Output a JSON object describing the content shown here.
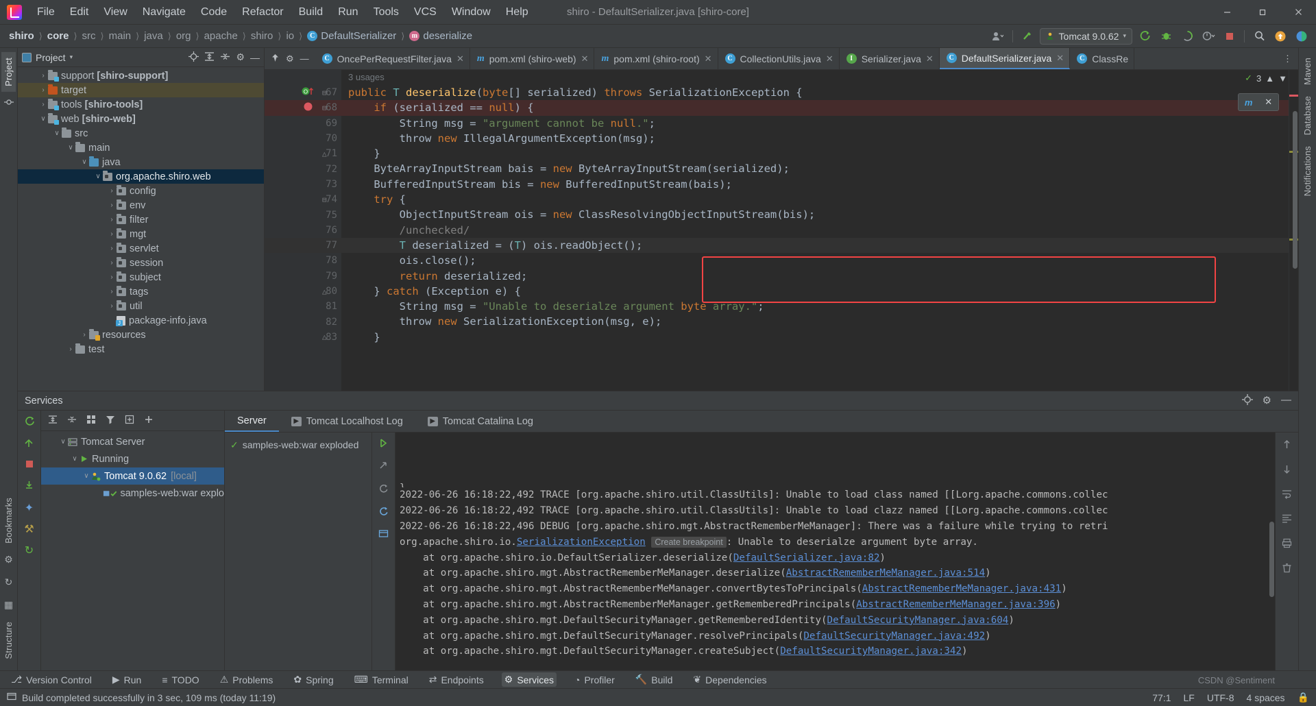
{
  "window": {
    "title": "shiro - DefaultSerializer.java [shiro-core]",
    "minimize": "—",
    "maximize": "❐",
    "close": "✕"
  },
  "menubar": {
    "items": [
      "File",
      "Edit",
      "View",
      "Navigate",
      "Code",
      "Refactor",
      "Build",
      "Run",
      "Tools",
      "VCS",
      "Window",
      "Help"
    ]
  },
  "breadcrumb": {
    "items": [
      {
        "label": "shiro",
        "style": "bold"
      },
      {
        "label": "core",
        "style": "bold"
      },
      {
        "label": "src",
        "style": "dim"
      },
      {
        "label": "main",
        "style": "dim"
      },
      {
        "label": "java",
        "style": "dim"
      },
      {
        "label": "org",
        "style": "dim"
      },
      {
        "label": "apache",
        "style": "dim"
      },
      {
        "label": "shiro",
        "style": "dim"
      },
      {
        "label": "io",
        "style": "dim"
      },
      {
        "label": "DefaultSerializer",
        "style": "class",
        "icon": "C"
      },
      {
        "label": "deserialize",
        "style": "method",
        "icon": "m"
      }
    ],
    "separator": "〉"
  },
  "toolbar": {
    "run_configuration": "Tomcat 9.0.62",
    "icons": {
      "profile": "profile-icon",
      "chevron": "▾",
      "build_hammer": "ⴰ",
      "run": "⟳",
      "debug": "debug-icon",
      "coverage": "coverage-icon",
      "profiler": "profiler-icon",
      "stop": "stop-icon",
      "search": "⌕",
      "updates": "↑",
      "ide_help": "ide-icon"
    }
  },
  "project_panel": {
    "title": "Project",
    "actions": [
      "locate-icon",
      "expand-all-icon",
      "collapse-all-icon",
      "settings-icon",
      "hide-icon"
    ],
    "tree": [
      {
        "label": "support [shiro-support]",
        "bold_part": "[shiro-support]",
        "indent": 1,
        "arrow": "›",
        "icon": "module",
        "state": "normal"
      },
      {
        "label": "target",
        "indent": 1,
        "arrow": "›",
        "icon": "excluded",
        "state": "highlight"
      },
      {
        "label": "tools [shiro-tools]",
        "bold_part": "[shiro-tools]",
        "indent": 1,
        "arrow": "›",
        "icon": "module",
        "state": "normal"
      },
      {
        "label": "web [shiro-web]",
        "bold_part": "[shiro-web]",
        "indent": 1,
        "arrow": "∨",
        "icon": "module",
        "state": "normal"
      },
      {
        "label": "src",
        "indent": 2,
        "arrow": "∨",
        "icon": "folder",
        "state": "normal"
      },
      {
        "label": "main",
        "indent": 3,
        "arrow": "∨",
        "icon": "folder",
        "state": "normal"
      },
      {
        "label": "java",
        "indent": 4,
        "arrow": "∨",
        "icon": "source",
        "state": "normal"
      },
      {
        "label": "org.apache.shiro.web",
        "indent": 5,
        "arrow": "∨",
        "icon": "package",
        "state": "selected"
      },
      {
        "label": "config",
        "indent": 6,
        "arrow": "›",
        "icon": "package",
        "state": "normal"
      },
      {
        "label": "env",
        "indent": 6,
        "arrow": "›",
        "icon": "package",
        "state": "normal"
      },
      {
        "label": "filter",
        "indent": 6,
        "arrow": "›",
        "icon": "package",
        "state": "normal"
      },
      {
        "label": "mgt",
        "indent": 6,
        "arrow": "›",
        "icon": "package",
        "state": "normal"
      },
      {
        "label": "servlet",
        "indent": 6,
        "arrow": "›",
        "icon": "package",
        "state": "normal"
      },
      {
        "label": "session",
        "indent": 6,
        "arrow": "›",
        "icon": "package",
        "state": "normal"
      },
      {
        "label": "subject",
        "indent": 6,
        "arrow": "›",
        "icon": "package",
        "state": "normal"
      },
      {
        "label": "tags",
        "indent": 6,
        "arrow": "›",
        "icon": "package",
        "state": "normal"
      },
      {
        "label": "util",
        "indent": 6,
        "arrow": "›",
        "icon": "package",
        "state": "normal"
      },
      {
        "label": "package-info.java",
        "indent": 6,
        "arrow": "",
        "icon": "javafile",
        "state": "normal"
      },
      {
        "label": "resources",
        "indent": 4,
        "arrow": "›",
        "icon": "resources",
        "state": "normal"
      },
      {
        "label": "test",
        "indent": 3,
        "arrow": "›",
        "icon": "folder",
        "state": "normal"
      }
    ]
  },
  "editor_tabs": {
    "lead_icons": [
      "pin-icon",
      "settings-icon",
      "minimize-icon"
    ],
    "tabs": [
      {
        "label": "OncePerRequestFilter.java",
        "icon": "C",
        "active": false,
        "close": "✕"
      },
      {
        "label": "pom.xml (shiro-web)",
        "icon": "m",
        "active": false,
        "close": "✕"
      },
      {
        "label": "pom.xml (shiro-root)",
        "icon": "m",
        "active": false,
        "close": "✕"
      },
      {
        "label": "CollectionUtils.java",
        "icon": "C",
        "active": false,
        "close": "✕"
      },
      {
        "label": "Serializer.java",
        "icon": "I",
        "active": false,
        "close": "✕"
      },
      {
        "label": "DefaultSerializer.java",
        "icon": "C",
        "active": true,
        "close": "✕"
      },
      {
        "label": "ClassRe",
        "icon": "C",
        "active": false,
        "close": ""
      }
    ],
    "overflow": "⋮"
  },
  "editor": {
    "usages_hint": "3 usages",
    "inspection_count": "3",
    "lines": [
      {
        "num": "67",
        "indent": 0,
        "mark": "method-gutter-icon"
      },
      {
        "num": "68",
        "indent": 0,
        "mark": "breakpoint"
      },
      {
        "num": "69",
        "indent": 0
      },
      {
        "num": "70",
        "indent": 0
      },
      {
        "num": "71",
        "indent": 0
      },
      {
        "num": "72",
        "indent": 0
      },
      {
        "num": "73",
        "indent": 0
      },
      {
        "num": "74",
        "indent": 0
      },
      {
        "num": "75",
        "indent": 0
      },
      {
        "num": "76",
        "indent": 0
      },
      {
        "num": "77",
        "indent": 0
      },
      {
        "num": "78",
        "indent": 0
      },
      {
        "num": "79",
        "indent": 0
      },
      {
        "num": "80",
        "indent": 0
      },
      {
        "num": "81",
        "indent": 0
      },
      {
        "num": "82",
        "indent": 0
      },
      {
        "num": "83",
        "indent": 0
      }
    ],
    "source_text": [
      "public T deserialize(byte[] serialized) throws SerializationException {",
      "    if (serialized == null) {",
      "        String msg = \"argument cannot be null.\";",
      "        throw new IllegalArgumentException(msg);",
      "    }",
      "    ByteArrayInputStream bais = new ByteArrayInputStream(serialized);",
      "    BufferedInputStream bis = new BufferedInputStream(bais);",
      "    try {",
      "        ObjectInputStream ois = new ClassResolvingObjectInputStream(bis);",
      "        /unchecked/",
      "        T deserialized = (T) ois.readObject();",
      "        ois.close();",
      "        return deserialized;",
      "    } catch (Exception e) {",
      "        String msg = \"Unable to deserialze argument byte array.\";",
      "        throw new SerializationException(msg, e);",
      "    }"
    ]
  },
  "services": {
    "title": "Services",
    "header_actions": [
      "locate-icon",
      "settings-icon",
      "hide-icon"
    ],
    "toolbar_icons": [
      "rerun-icon",
      "expand-icon",
      "collapse-icon",
      "stop-icon",
      "deploy-icon",
      "wrench-icon",
      "refresh-icon"
    ],
    "tree_toolbar_icons": [
      "expand-all-icon",
      "collapse-all-icon",
      "group-icon",
      "filter-icon",
      "show-icon",
      "add-icon"
    ],
    "tree": [
      {
        "label": "Tomcat Server",
        "indent": 1,
        "arrow": "∨",
        "icon": "server-icon",
        "state": "normal"
      },
      {
        "label": "Running",
        "indent": 2,
        "arrow": "∨",
        "icon": "run-green-icon",
        "state": "normal"
      },
      {
        "label": "Tomcat 9.0.62",
        "suffix": "[local]",
        "indent": 3,
        "arrow": "∨",
        "icon": "tomcat-icon",
        "state": "selected"
      },
      {
        "label": "samples-web:war explo",
        "indent": 4,
        "arrow": "",
        "icon": "artifact-ok-icon",
        "state": "normal"
      }
    ],
    "tabs": [
      {
        "label": "Server",
        "active": true
      },
      {
        "label": "Tomcat Localhost Log",
        "active": false,
        "icon": "run-icon"
      },
      {
        "label": "Tomcat Catalina Log",
        "active": false,
        "icon": "run-icon"
      }
    ],
    "run_items": [
      {
        "label": "samples-web:war exploded",
        "icon": "check-icon"
      }
    ],
    "console_toolbar_icons": [
      "rerun-icon",
      "redeploy-icon",
      "restart-icon",
      "update-icon",
      "browser-icon"
    ],
    "right_toolbar_icons": [
      "scroll-up-icon",
      "scroll-down-icon",
      "soft-wrap-icon",
      "scroll-end-icon",
      "print-icon",
      "clear-icon"
    ],
    "console_lines": [
      {
        "text": "2022-06-26 16:18:22,492 TRACE [org.apache.shiro.util.ClassUtils]: Unable to load class named [[Lorg.apache.commons.collec"
      },
      {
        "text": "2022-06-26 16:18:22,492 TRACE [org.apache.shiro.util.ClassUtils]: Unable to load clazz named [[Lorg.apache.commons.collec"
      },
      {
        "text": "2022-06-26 16:18:22,496 DEBUG [org.apache.shiro.mgt.AbstractRememberMeManager]: There was a failure while trying to retri"
      },
      {
        "parts": [
          {
            "text": "org.apache.shiro.io.",
            "type": "plain"
          },
          {
            "text": "SerializationException",
            "type": "link"
          },
          {
            "text": "Create breakpoint",
            "type": "chip"
          },
          {
            "text": ": Unable to deserialze argument byte array.",
            "type": "plain"
          }
        ]
      },
      {
        "parts": [
          {
            "text": "    at org.apache.shiro.io.DefaultSerializer.deserialize(",
            "type": "plain"
          },
          {
            "text": "DefaultSerializer.java:82",
            "type": "link"
          },
          {
            "text": ")",
            "type": "plain"
          }
        ]
      },
      {
        "parts": [
          {
            "text": "    at org.apache.shiro.mgt.AbstractRememberMeManager.deserialize(",
            "type": "plain"
          },
          {
            "text": "AbstractRememberMeManager.java:514",
            "type": "link"
          },
          {
            "text": ")",
            "type": "plain"
          }
        ]
      },
      {
        "parts": [
          {
            "text": "    at org.apache.shiro.mgt.AbstractRememberMeManager.convertBytesToPrincipals(",
            "type": "plain"
          },
          {
            "text": "AbstractRememberMeManager.java:431",
            "type": "link"
          },
          {
            "text": ")",
            "type": "plain"
          }
        ]
      },
      {
        "parts": [
          {
            "text": "    at org.apache.shiro.mgt.AbstractRememberMeManager.getRememberedPrincipals(",
            "type": "plain"
          },
          {
            "text": "AbstractRememberMeManager.java:396",
            "type": "link"
          },
          {
            "text": ")",
            "type": "plain"
          }
        ]
      },
      {
        "parts": [
          {
            "text": "    at org.apache.shiro.mgt.DefaultSecurityManager.getRememberedIdentity(",
            "type": "plain"
          },
          {
            "text": "DefaultSecurityManager.java:604",
            "type": "link"
          },
          {
            "text": ")",
            "type": "plain"
          }
        ]
      },
      {
        "parts": [
          {
            "text": "    at org.apache.shiro.mgt.DefaultSecurityManager.resolvePrincipals(",
            "type": "plain"
          },
          {
            "text": "DefaultSecurityManager.java:492",
            "type": "link"
          },
          {
            "text": ")",
            "type": "plain"
          }
        ]
      },
      {
        "parts": [
          {
            "text": "    at org.apache.shiro.mgt.DefaultSecurityManager.createSubject(",
            "type": "plain"
          },
          {
            "text": "DefaultSecurityManager.java:342",
            "type": "link"
          },
          {
            "text": ")",
            "type": "plain"
          }
        ]
      }
    ]
  },
  "tool_window_bar": {
    "items": [
      {
        "label": "Version Control",
        "icon": "⎇"
      },
      {
        "label": "Run",
        "icon": "▶"
      },
      {
        "label": "TODO",
        "icon": "≡"
      },
      {
        "label": "Problems",
        "icon": "⚠"
      },
      {
        "label": "Spring",
        "icon": "✿"
      },
      {
        "label": "Terminal",
        "icon": "⌨"
      },
      {
        "label": "Endpoints",
        "icon": "⇄"
      },
      {
        "label": "Services",
        "icon": "⚙",
        "active": true
      },
      {
        "label": "Profiler",
        "icon": "◔"
      },
      {
        "label": "Build",
        "icon": "🔨"
      },
      {
        "label": "Dependencies",
        "icon": "❦"
      }
    ]
  },
  "left_rail": {
    "tabs": [
      "Project",
      "Bookmarks",
      "Structure"
    ],
    "icons": [
      "commit-icon",
      "pull-requests-icon",
      "structure-icon"
    ]
  },
  "right_rail": {
    "tabs": [
      "Maven",
      "Database",
      "Notifications"
    ]
  },
  "status_bar": {
    "message": "Build completed successfully in 3 sec, 109 ms (today 11:19)",
    "caret": "77:1",
    "line_separator": "LF",
    "encoding": "UTF-8",
    "indent": "4 spaces",
    "watermark": "CSDN @Sentiment"
  },
  "colors": {
    "accent": "#4a88c7",
    "selection": "#0d293e",
    "editor_bg": "#2b2b2b",
    "panel_bg": "#3c3f41",
    "highlight_box": "#f24444",
    "breakpoint": "#db5860",
    "keyword": "#cc7832",
    "string": "#6a8759",
    "link": "#5c8fd6"
  }
}
